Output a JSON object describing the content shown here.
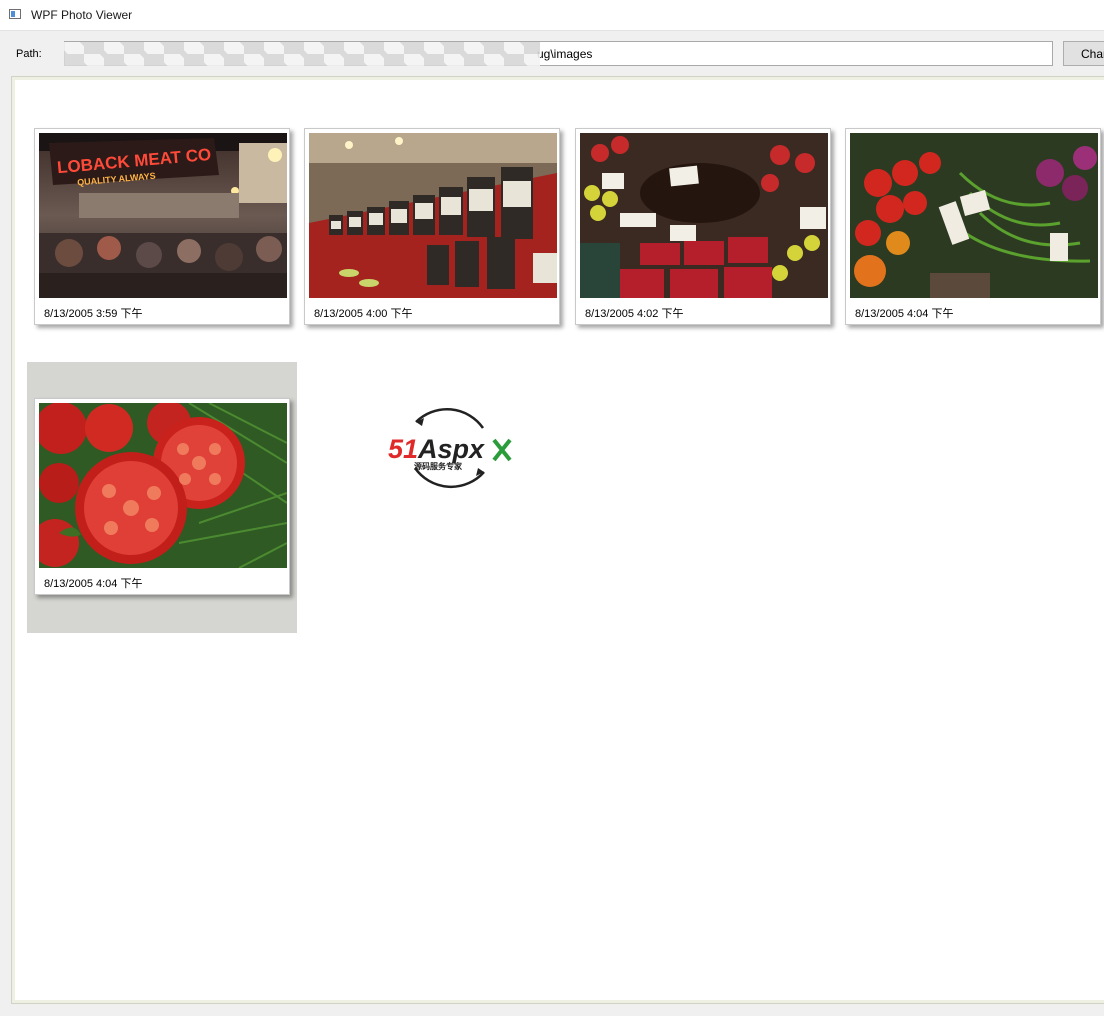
{
  "window": {
    "title": "WPF Photo Viewer",
    "icon": "window-app-icon"
  },
  "pathbar": {
    "label": "Path:",
    "value": "ug\\images",
    "button_label": "Change"
  },
  "photos": [
    {
      "caption": "8/13/2005 3:59 下午",
      "subject": "market neon sign and crowd",
      "selected": false
    },
    {
      "caption": "8/13/2005 4:00 下午",
      "subject": "jars on red shelf",
      "selected": false
    },
    {
      "caption": "8/13/2005 4:02 下午",
      "subject": "fruit stand with price signs",
      "selected": false
    },
    {
      "caption": "8/13/2005 4:04 下午",
      "subject": "vegetable stand",
      "selected": false
    },
    {
      "caption": "8/13/2005 4:04 下午",
      "subject": "sliced tomatoes",
      "selected": true
    }
  ],
  "watermark": {
    "brand": "51Aspx",
    "brand_num": "51",
    "brand_word": "Aspx",
    "tagline": "源码服务专家"
  },
  "colors": {
    "selection": "#d5d6d1",
    "brand_red": "#e02a2a",
    "brand_green": "#2a9d3a"
  }
}
